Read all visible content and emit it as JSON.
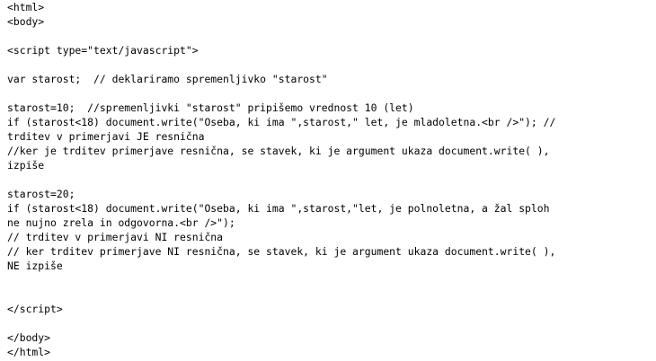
{
  "lines": [
    "<html>",
    "<body>",
    "",
    "<script type=\"text/javascript\">",
    "",
    "var starost;  // deklariramo spremenljivko \"starost\"",
    "",
    "starost=10;  //spremenljivki \"starost\" pripišemo vrednost 10 (let)",
    "if (starost<18) document.write(\"Oseba, ki ima \",starost,\" let, je mladoletna.<br />\"); //",
    "trditev v primerjavi JE resnična",
    "//ker je trditev primerjave resnična, se stavek, ki je argument ukaza document.write( ),",
    "izpiše",
    "",
    "starost=20;",
    "if (starost<18) document.write(\"Oseba, ki ima \",starost,\"let, je polnoletna, a žal sploh",
    "ne nujno zrela in odgovorna.<br />\");",
    "// trditev v primerjavi NI resnična",
    "// ker trditev primerjave NI resnična, se stavek, ki je argument ukaza document.write( ),",
    "NE izpiše",
    "",
    "",
    "</script>",
    "",
    "</body>",
    "</html>"
  ]
}
